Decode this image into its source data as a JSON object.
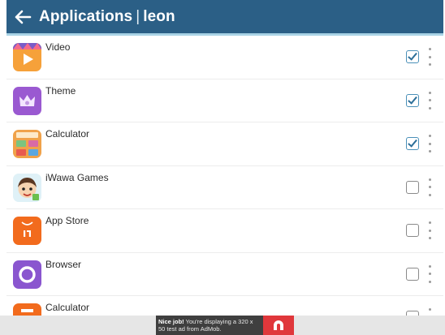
{
  "appbar": {
    "title": "Applications",
    "separator": "|",
    "user": "leon"
  },
  "apps": [
    {
      "label": "Video",
      "checked": true,
      "icon": "video-icon"
    },
    {
      "label": "Theme",
      "checked": true,
      "icon": "theme-icon"
    },
    {
      "label": "Calculator",
      "checked": true,
      "icon": "calculator-icon"
    },
    {
      "label": "iWawa Games",
      "checked": false,
      "icon": "iwawa-games-icon"
    },
    {
      "label": "App Store",
      "checked": false,
      "icon": "app-store-icon"
    },
    {
      "label": "Browser",
      "checked": false,
      "icon": "browser-icon"
    },
    {
      "label": "Calculator",
      "checked": false,
      "icon": "calculator-icon"
    }
  ],
  "ad": {
    "headline": "Nice job!",
    "text": "You're displaying a 320 x 50 test ad from AdMob."
  },
  "colors": {
    "appbar": "#2b5f86",
    "accent": "#4a90b8"
  }
}
